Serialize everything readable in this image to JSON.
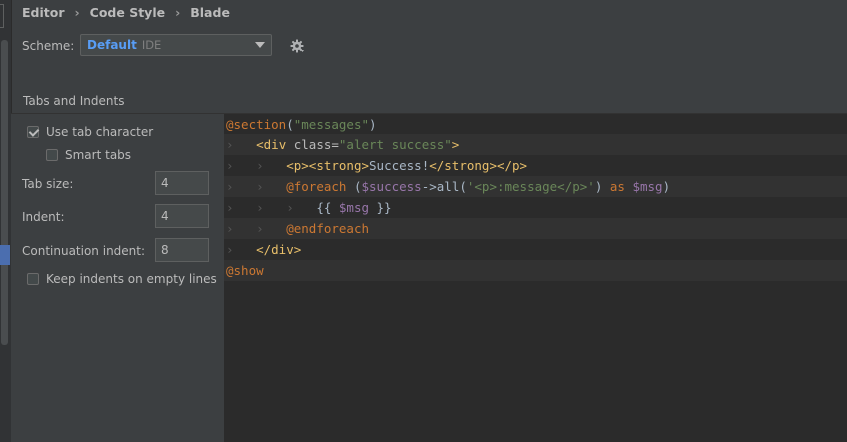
{
  "breadcrumb": [
    "Editor",
    "Code Style",
    "Blade"
  ],
  "scheme": {
    "label": "Scheme:",
    "value": "Default",
    "sub": "IDE"
  },
  "tabs": [
    {
      "label": "Tabs and Indents"
    }
  ],
  "options": {
    "use_tab": {
      "label": "Use tab character",
      "checked": true
    },
    "smart_tabs": {
      "label": "Smart tabs",
      "checked": false
    },
    "tab_size": {
      "label": "Tab size:",
      "value": "4"
    },
    "indent": {
      "label": "Indent:",
      "value": "4"
    },
    "continuation": {
      "label": "Continuation indent:",
      "value": "8"
    },
    "keep_indents": {
      "label": "Keep indents on empty lines",
      "checked": false
    }
  },
  "code": {
    "l1": {
      "directive": "@section",
      "open": "(",
      "str": "\"messages\"",
      "close": ")"
    },
    "l2": {
      "guides": "›   ",
      "lt": "<",
      "tag": "div",
      "attr": " class=",
      "val": "\"alert success\"",
      "gt": ">"
    },
    "l3": {
      "guides": "›   ›   ",
      "t1": "<p><strong>",
      "txt": "Success!",
      "t2": "</strong></p>"
    },
    "l4": {
      "guides": "›   ›   ",
      "directive": "@foreach",
      "p1": " (",
      "var1": "$success",
      "mid": "->all(",
      "str": "'<p>:message</p>'",
      "p2": ") ",
      "as": "as",
      "sp": " ",
      "var2": "$msg",
      "p3": ")"
    },
    "l5": {
      "guides": "›   ›   ›   ",
      "o": "{{ ",
      "var": "$msg",
      "c": " }}"
    },
    "l6": {
      "guides": "›   ›   ",
      "directive": "@endforeach"
    },
    "l7": {
      "guides": "›   ",
      "tag": "</div>"
    },
    "l8": {
      "directive": "@show"
    }
  },
  "colors": {
    "accent": "#589df6",
    "keyword": "#cc7832",
    "string": "#6a8759",
    "tag": "#e8bf6a",
    "variable": "#9876aa",
    "editor_bg": "#2b2b2b",
    "panel_bg": "#3c3f41"
  }
}
